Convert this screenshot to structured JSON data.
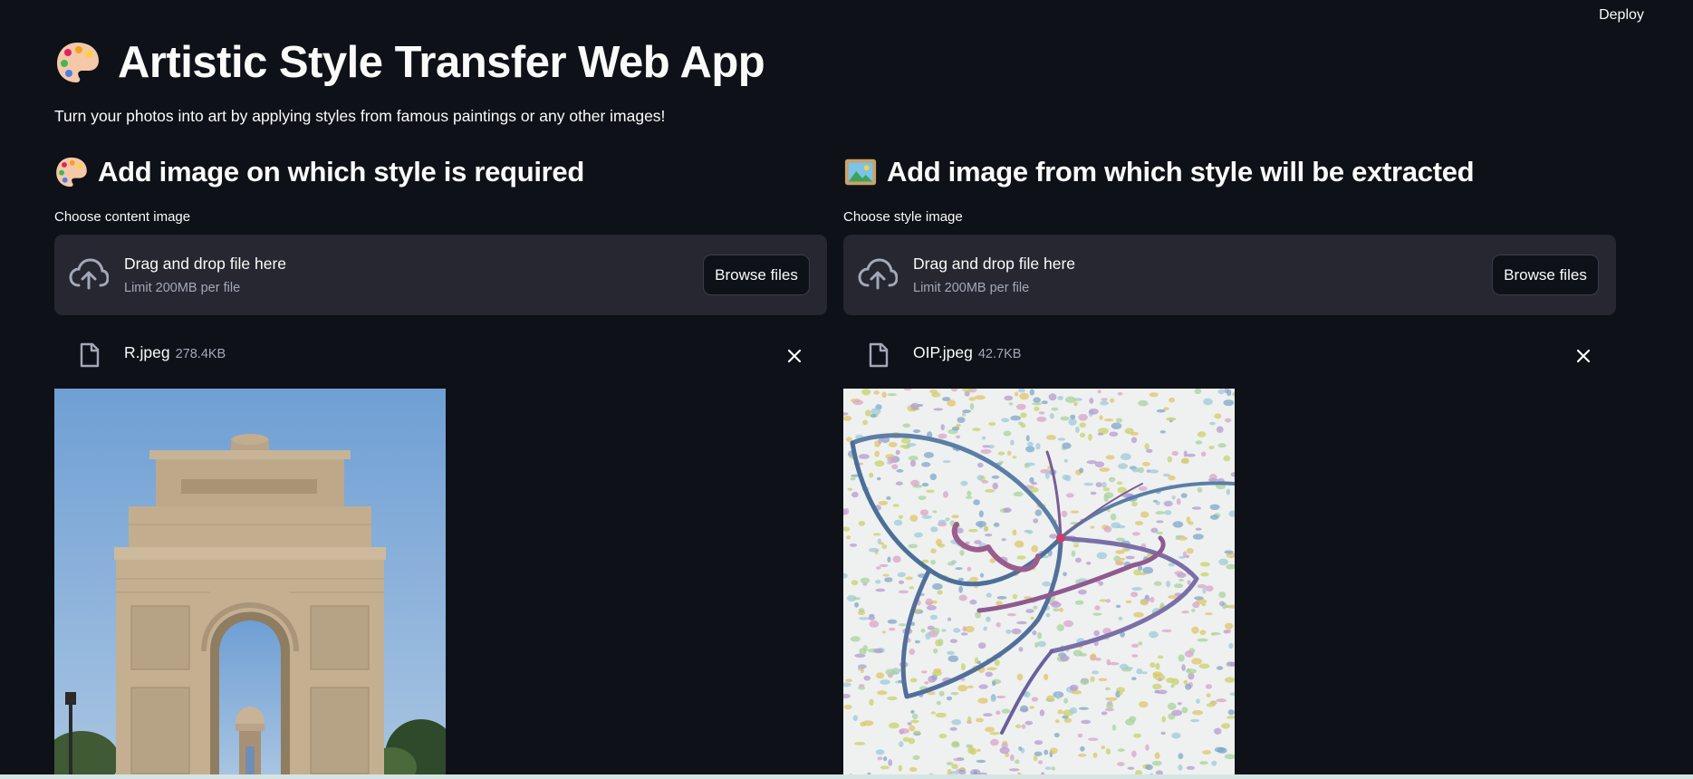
{
  "toolbar": {
    "deploy_label": "Deploy"
  },
  "page": {
    "title": "Artistic Style Transfer Web App",
    "title_icon": "artist-palette-icon",
    "subtitle": "Turn your photos into art by applying styles from famous paintings or any other images!"
  },
  "content_column": {
    "header": "Add image on which style is required",
    "header_icon": "artist-palette-icon",
    "uploader_label": "Choose content image",
    "dropzone_text": "Drag and drop file here",
    "limit_text": "Limit 200MB per file",
    "browse_label": "Browse files",
    "file": {
      "name": "R.jpeg",
      "size": "278.4KB"
    },
    "preview_icon": "india-gate-photo"
  },
  "style_column": {
    "header": "Add image from which style will be extracted",
    "header_icon": "framed-picture-icon",
    "uploader_label": "Choose style image",
    "dropzone_text": "Drag and drop file here",
    "limit_text": "Limit 200MB per file",
    "browse_label": "Browse files",
    "file": {
      "name": "OIP.jpeg",
      "size": "42.7KB"
    },
    "preview_icon": "butterfly-sketch-image"
  },
  "colors": {
    "background": "#0e1117",
    "dropzone": "#262730",
    "text": "#fafafa",
    "muted": "#a3a8b8"
  }
}
